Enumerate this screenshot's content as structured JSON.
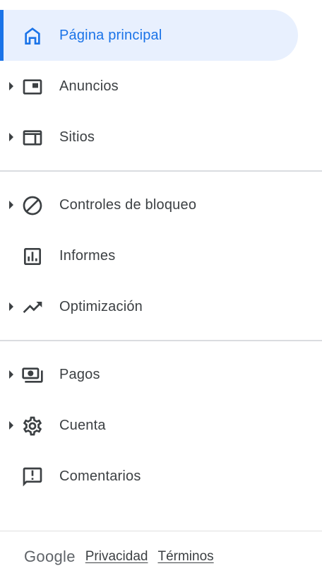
{
  "nav": {
    "items": [
      {
        "label": "Página principal",
        "icon": "home-icon",
        "has_caret": false,
        "active": true
      },
      {
        "label": "Anuncios",
        "icon": "ads-icon",
        "has_caret": true,
        "active": false
      },
      {
        "label": "Sitios",
        "icon": "sites-icon",
        "has_caret": true,
        "active": false
      },
      {
        "label": "Controles de bloqueo",
        "icon": "block-icon",
        "has_caret": true,
        "active": false
      },
      {
        "label": "Informes",
        "icon": "reports-icon",
        "has_caret": false,
        "active": false
      },
      {
        "label": "Optimización",
        "icon": "trending-up-icon",
        "has_caret": true,
        "active": false
      },
      {
        "label": "Pagos",
        "icon": "payments-icon",
        "has_caret": true,
        "active": false
      },
      {
        "label": "Cuenta",
        "icon": "gear-icon",
        "has_caret": true,
        "active": false
      },
      {
        "label": "Comentarios",
        "icon": "feedback-icon",
        "has_caret": false,
        "active": false
      }
    ]
  },
  "footer": {
    "logo_text": "Google",
    "privacy_label": "Privacidad",
    "terms_label": "Términos"
  },
  "colors": {
    "accent": "#1a73e8",
    "active_background": "#e8f0fe",
    "text": "#3c4043",
    "divider": "#dadce0"
  }
}
